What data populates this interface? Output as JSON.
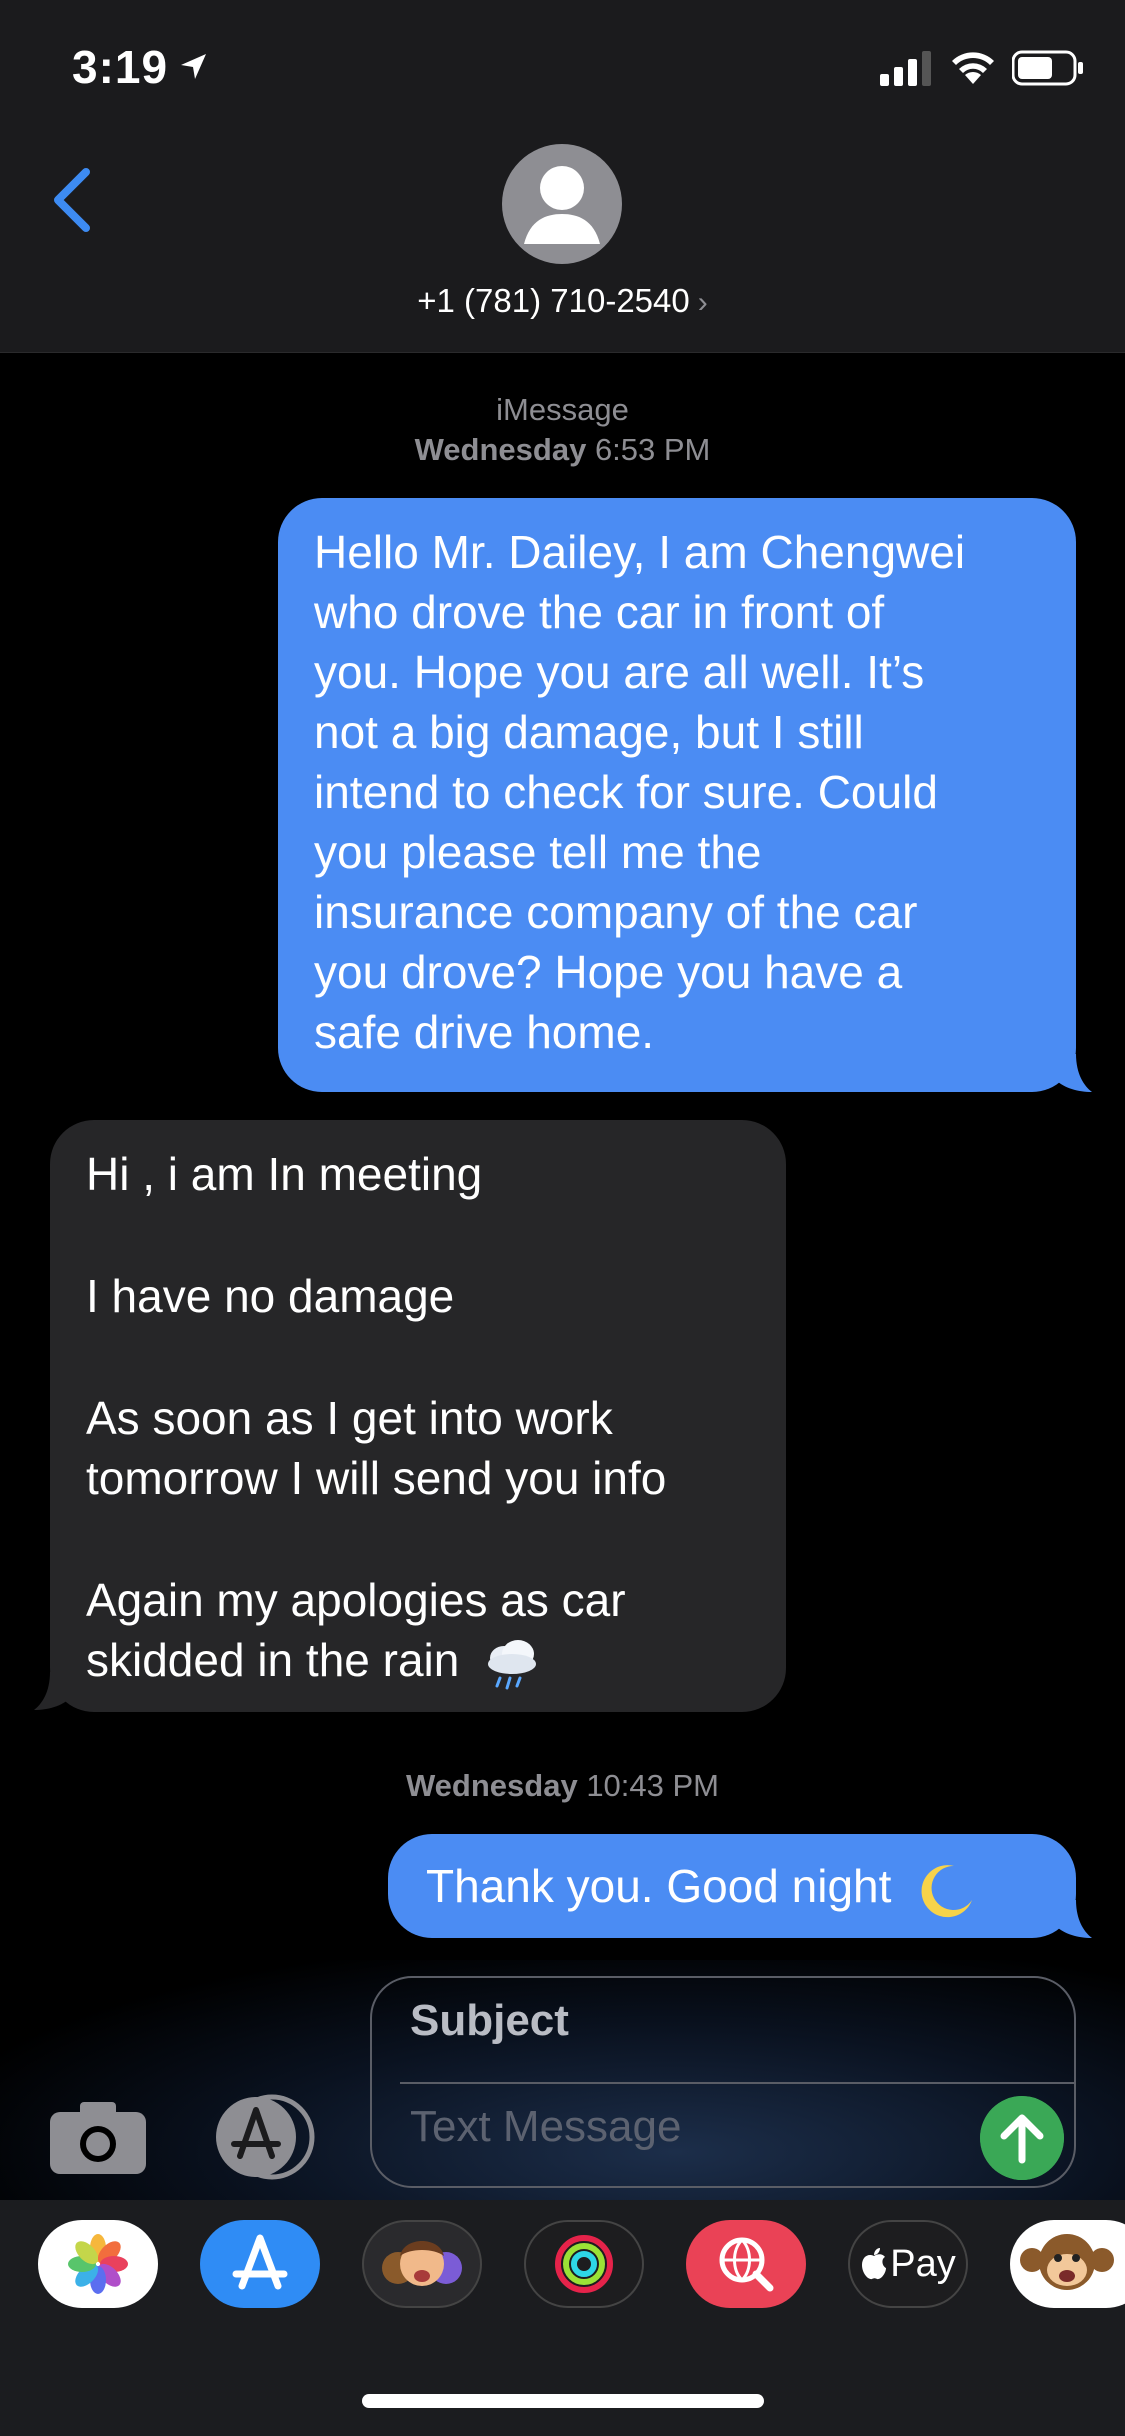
{
  "status_bar": {
    "time": "3:19"
  },
  "header": {
    "contact": "+1 (781) 710-2540",
    "chevron": "›"
  },
  "thread": {
    "service": "iMessage",
    "timestamp1_day": "Wednesday",
    "timestamp1_time": "6:53 PM",
    "msg1_lines": [
      "Hello Mr. Dailey, I am Chengwei",
      "who drove the car in front of",
      "you. Hope you are all well. It’s",
      "not a big damage, but I still",
      "intend to check for sure. Could",
      "you please tell me the",
      "insurance company of the car",
      "you drove? Hope you have a",
      "safe drive home."
    ],
    "msg2_lines": [
      "Hi , i am In meeting",
      "",
      "I have no damage",
      "",
      "As soon as I get into work",
      "tomorrow I will send you info",
      "",
      "Again my apologies as car",
      "skidded in the rain"
    ],
    "msg2_emoji": "rain-cloud",
    "timestamp2_day": "Wednesday",
    "timestamp2_time": "10:43 PM",
    "msg3": "Thank you. Good night",
    "msg3_emoji": "crescent-moon"
  },
  "composer": {
    "subject_placeholder": "Subject",
    "text_placeholder": "Text Message"
  },
  "app_drawer": {
    "apps": [
      "photos",
      "app-store",
      "memoji",
      "activity",
      "search-images",
      "apple-pay",
      "animoji-monkey"
    ],
    "apple_pay_label": "Pay"
  },
  "colors": {
    "outgoing_bubble": "#4b8cf3",
    "incoming_bubble": "#262628",
    "accent": "#3d8bf2",
    "send_button": "#3aa856"
  }
}
